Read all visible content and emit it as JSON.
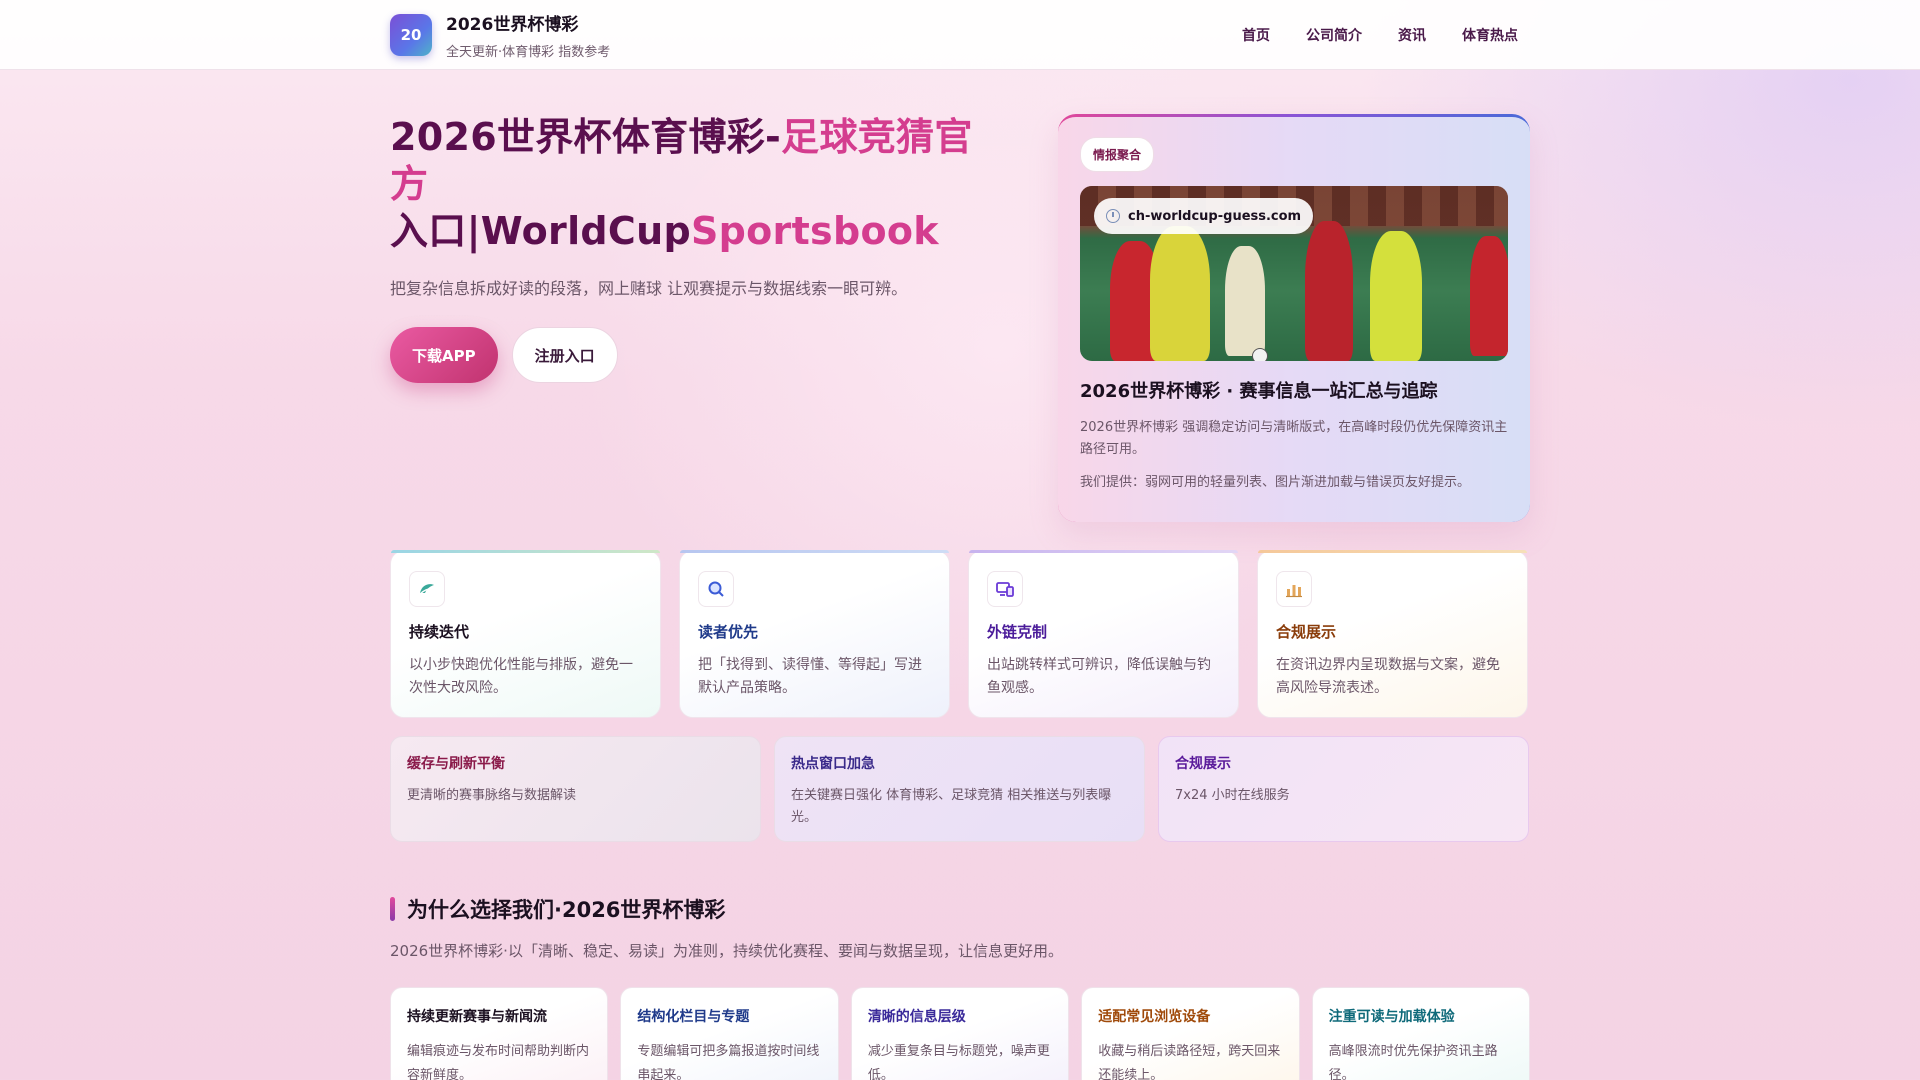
{
  "header": {
    "logo_text": "20",
    "brand_name": "2026世界杯博彩",
    "brand_sub": "全天更新·体育博彩 指数参考",
    "nav": [
      "首页",
      "公司简介",
      "资讯",
      "体育热点"
    ]
  },
  "hero": {
    "title_part1": "2026世界杯体育博彩-",
    "title_part2": "足球竞猜官方",
    "title_part3": "入口|WorldCup",
    "title_part4": "Sportsbook",
    "description": "把复杂信息拆成好读的段落，网上赌球 让观赛提示与数据线索一眼可辨。",
    "btn_download": "下载APP",
    "btn_register": "注册入口"
  },
  "hero_card": {
    "tag": "情报聚合",
    "url": "ch-worldcup-guess.com",
    "title": "2026世界杯博彩 · 赛事信息一站汇总与追踪",
    "para1": "2026世界杯博彩 强调稳定访问与清晰版式，在高峰时段仍优先保障资讯主路径可用。",
    "para2": "我们提供：弱网可用的轻量列表、图片渐进加载与错误页友好提示。"
  },
  "features": [
    {
      "title": "持续迭代",
      "desc": "以小步快跑优化性能与排版，避免一次性大改风险。",
      "icon": "leaf-icon",
      "color": "#1b1020"
    },
    {
      "title": "读者优先",
      "desc": "把「找得到、读得懂、等得起」写进默认产品策略。",
      "icon": "search-icon",
      "color": "#1f3a8a"
    },
    {
      "title": "外链克制",
      "desc": "出站跳转样式可辨识，降低误触与钓鱼观感。",
      "icon": "devices-icon",
      "color": "#4b1c9a"
    },
    {
      "title": "合规展示",
      "desc": "在资讯边界内呈现数据与文案，避免高风险导流表述。",
      "icon": "chart-icon",
      "color": "#8a3c0a"
    }
  ],
  "highlights": [
    {
      "title": "缓存与刷新平衡",
      "desc": "更清晰的赛事脉络与数据解读",
      "color": "#8a1a4a"
    },
    {
      "title": "热点窗口加急",
      "desc": "在关键赛日强化 体育博彩、足球竞猜 相关推送与列表曝光。",
      "color": "#3a2a8a"
    },
    {
      "title": "合规展示",
      "desc": "7x24 小时在线服务",
      "color": "#5a1a9a"
    }
  ],
  "why": {
    "title": "为什么选择我们·2026世界杯博彩",
    "desc": "2026世界杯博彩·以「清晰、稳定、易读」为准则，持续优化赛程、要闻与数据呈现，让信息更好用。",
    "cards": [
      {
        "title": "持续更新赛事与新闻流",
        "desc": "编辑痕迹与发布时间帮助判断内容新鲜度。",
        "color": "#1b1020"
      },
      {
        "title": "结构化栏目与专题",
        "desc": "专题编辑可把多篇报道按时间线串起来。",
        "color": "#1f3a8a"
      },
      {
        "title": "清晰的信息层级",
        "desc": "减少重复条目与标题党，噪声更低。",
        "color": "#3a2a9a"
      },
      {
        "title": "适配常见浏览设备",
        "desc": "收藏与稍后读路径短，跨天回来还能续上。",
        "color": "#a04a0a"
      },
      {
        "title": "注重可读与加载体验",
        "desc": "高峰限流时优先保护资讯主路径。",
        "color": "#0f6a7a"
      }
    ]
  }
}
